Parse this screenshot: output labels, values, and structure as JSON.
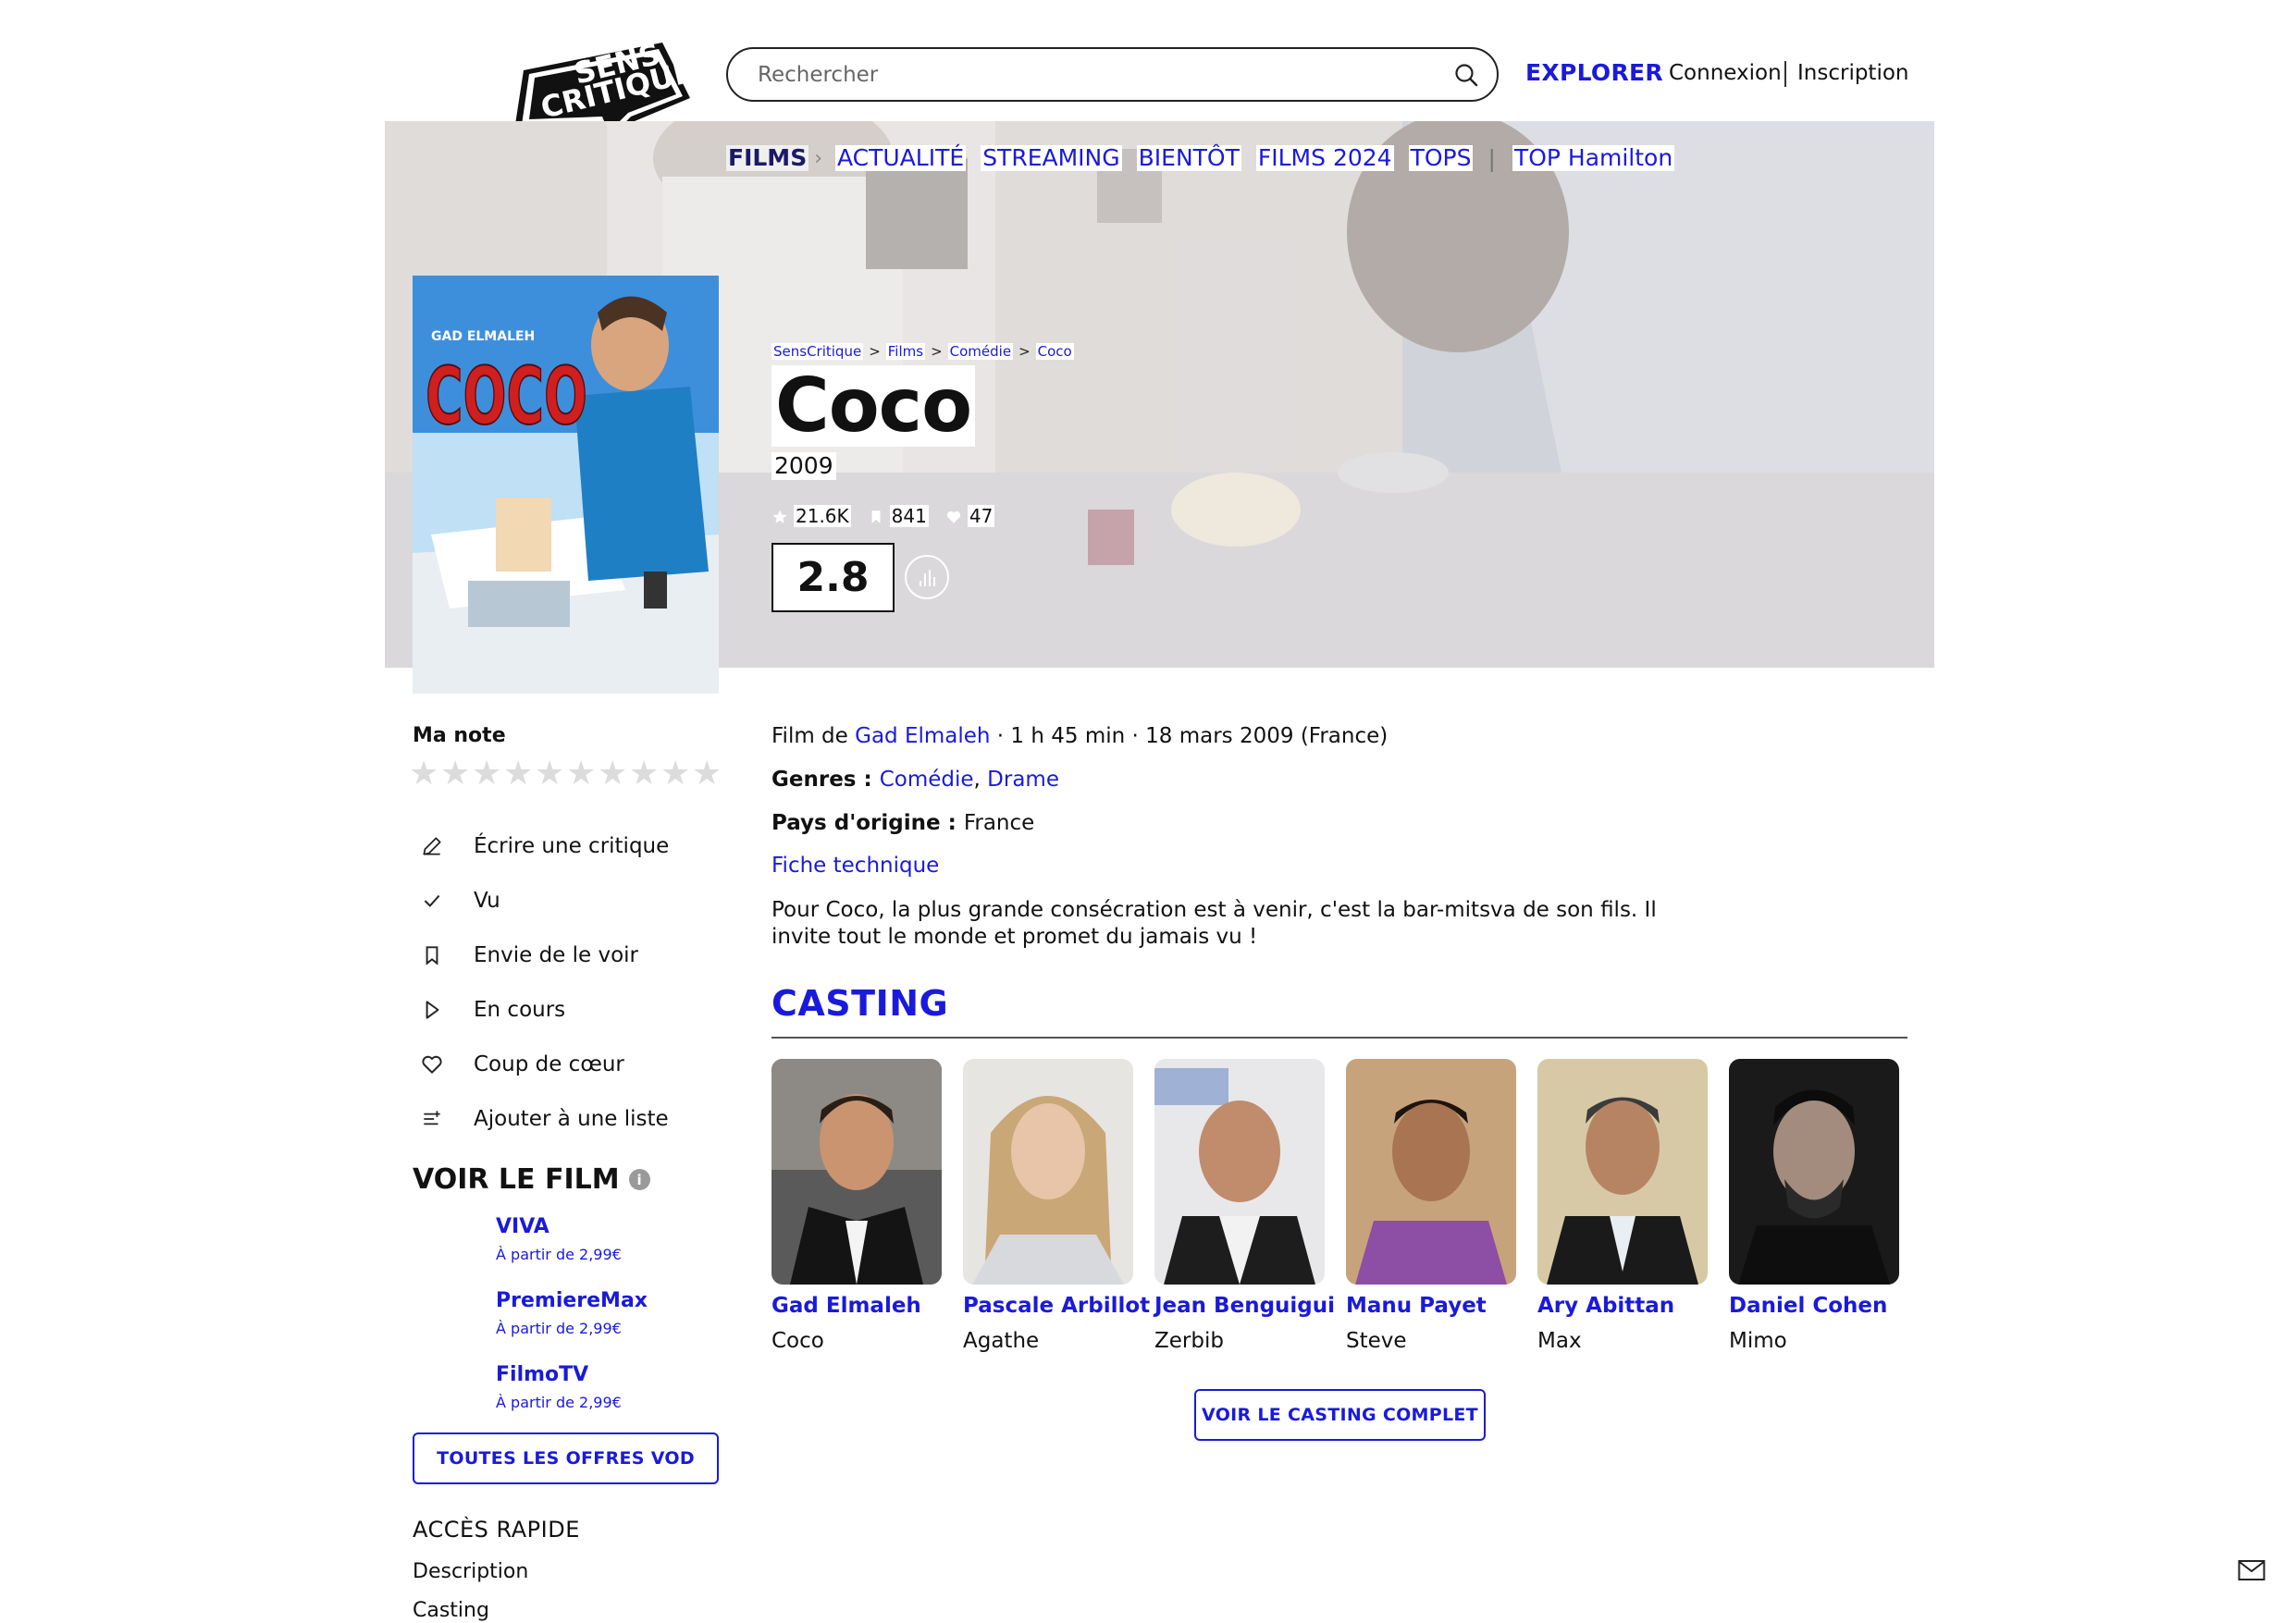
{
  "header": {
    "logo_text_1": "SENS",
    "logo_text_2": "CRITIQUE",
    "search_placeholder": "Rechercher",
    "explorer": "EXPLORER",
    "login": "Connexion",
    "signup": "Inscription"
  },
  "nav": {
    "films": "FILMS",
    "items": [
      "ACTUALITÉ",
      "STREAMING",
      "BIENTÔT",
      "FILMS 2024",
      "TOPS"
    ],
    "top_label": "TOP Hamilton"
  },
  "poster": {
    "actor": "GAD ELMALEH",
    "title": "COCO"
  },
  "breadcrumb": [
    "SensCritique",
    "Films",
    "Comédie",
    "Coco"
  ],
  "movie": {
    "title": "Coco",
    "year": "2009",
    "stats": {
      "ratings": "21.6K",
      "wishlist": "841",
      "favorites": "47"
    },
    "score": "2.8"
  },
  "details": {
    "film_de_prefix": "Film de ",
    "director": "Gad Elmaleh",
    "info_suffix": " · 1 h 45 min · 18 mars 2009 (France)",
    "genres_label": "Genres : ",
    "genre_1": "Comédie",
    "genre_sep": ", ",
    "genre_2": "Drame",
    "pays_label": "Pays d'origine : ",
    "pays": "France",
    "fiche": "Fiche technique",
    "synopsis": "Pour Coco, la plus grande consécration est à venir, c'est la bar-mitsva de son fils. Il invite tout le monde et promet du jamais vu !"
  },
  "my_rating": {
    "label": "Ma note",
    "stars_count": 10
  },
  "actions": [
    {
      "label": "Écrire une critique",
      "icon": "pencil-icon"
    },
    {
      "label": "Vu",
      "icon": "check-icon"
    },
    {
      "label": "Envie de le voir",
      "icon": "bookmark-icon"
    },
    {
      "label": "En cours",
      "icon": "play-icon"
    },
    {
      "label": "Coup de cœur",
      "icon": "heart-icon"
    },
    {
      "label": "Ajouter à une liste",
      "icon": "list-add-icon"
    }
  ],
  "watch": {
    "title": "VOIR LE FILM",
    "info_glyph": "i",
    "offers": [
      {
        "name": "VIVA",
        "price": "À partir de 2,99€"
      },
      {
        "name": "PremiereMax",
        "price": "À partir de 2,99€"
      },
      {
        "name": "FilmoTV",
        "price": "À partir de 2,99€"
      }
    ],
    "all_button": "TOUTES LES OFFRES VOD"
  },
  "quick_access": {
    "title": "ACCÈS RAPIDE",
    "items": [
      "Description",
      "Casting"
    ]
  },
  "casting": {
    "title": "CASTING",
    "people": [
      {
        "name": "Gad Elmaleh",
        "role": "Coco"
      },
      {
        "name": "Pascale Arbillot",
        "role": "Agathe"
      },
      {
        "name": "Jean Benguigui",
        "role": "Zerbib"
      },
      {
        "name": "Manu Payet",
        "role": "Steve"
      },
      {
        "name": "Ary Abittan",
        "role": "Max"
      },
      {
        "name": "Daniel Cohen",
        "role": "Mimo"
      }
    ],
    "all_button": "VOIR LE CASTING COMPLET"
  },
  "colors": {
    "accent": "#1a1adb",
    "text": "#111111",
    "star_empty": "#dcdcdc"
  }
}
